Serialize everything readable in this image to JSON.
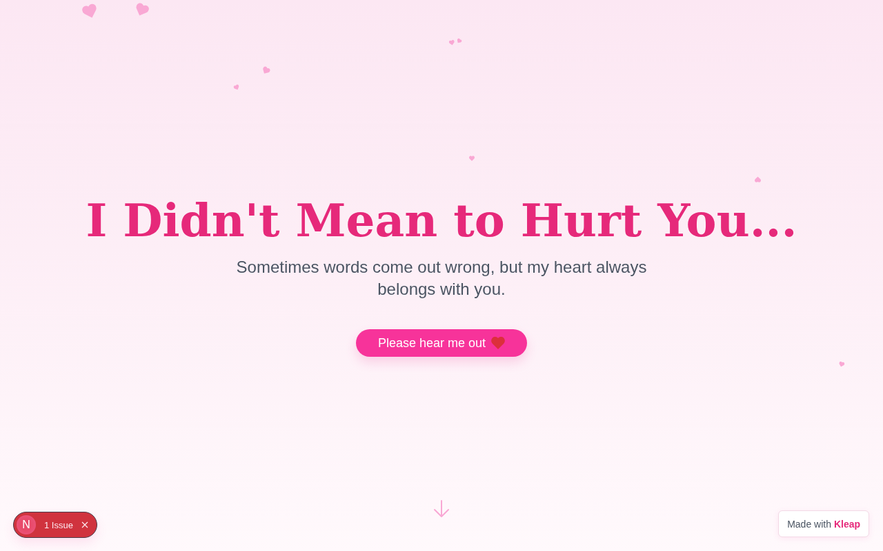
{
  "hero": {
    "title": "I Didn't Mean to Hurt You...",
    "subtitle": "Sometimes words come out wrong, but my heart always belongs with you.",
    "button": {
      "label": "Please hear me out"
    }
  },
  "issues_badge": {
    "logo": "N",
    "label": "1 Issue"
  },
  "credit": {
    "text": "Made with **Kleap**"
  }
}
